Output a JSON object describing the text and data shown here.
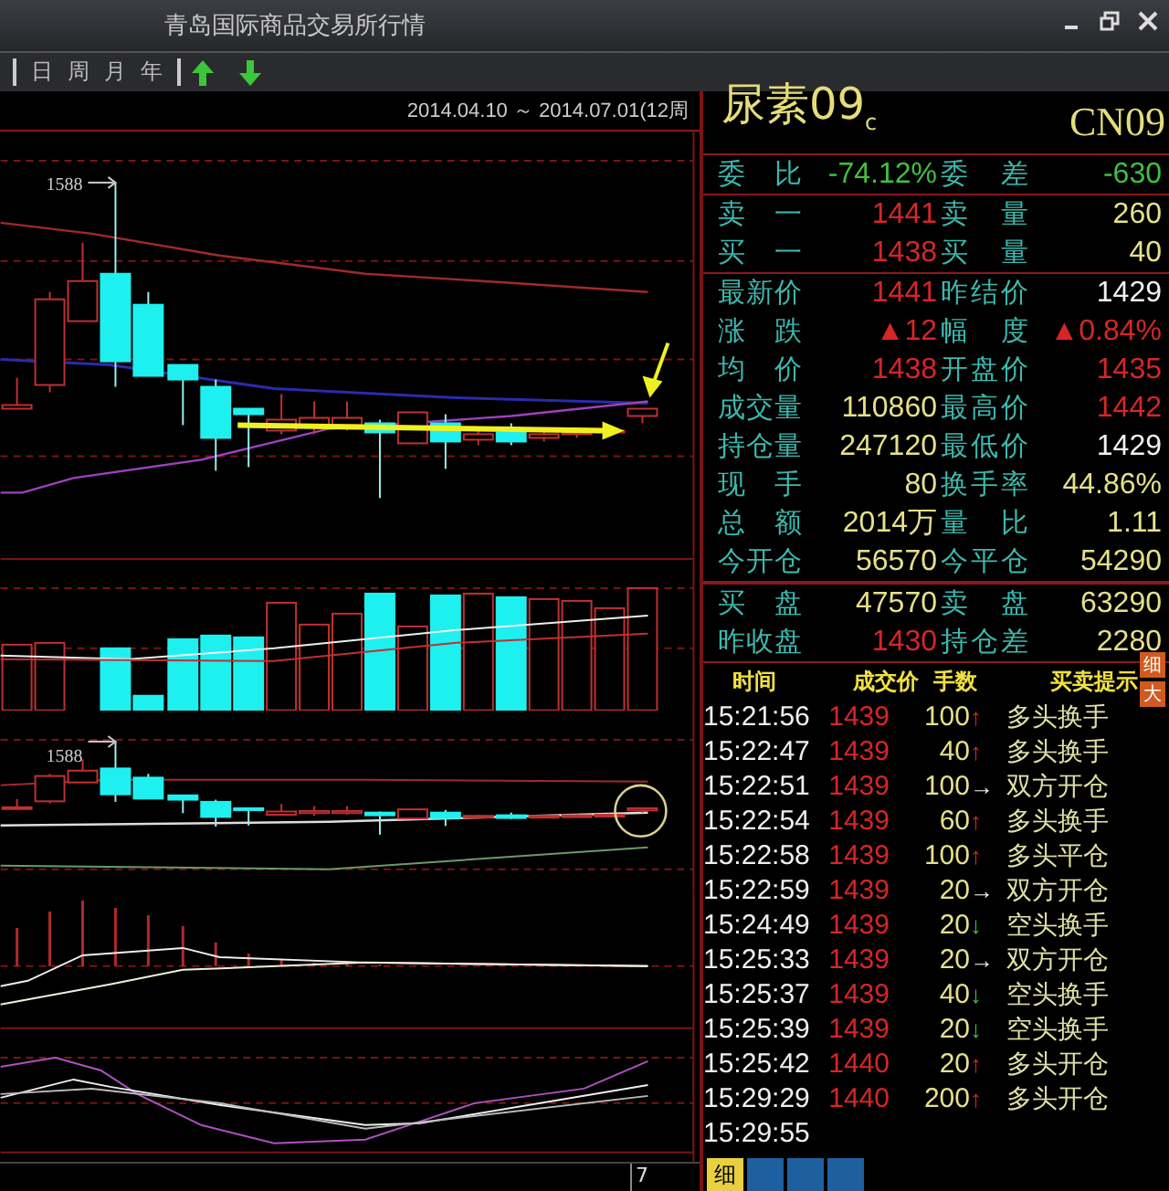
{
  "window": {
    "title": "青岛国际商品交易所行情"
  },
  "toolbar": {
    "periods": [
      {
        "label": "日"
      },
      {
        "label": "周"
      },
      {
        "label": "月"
      },
      {
        "label": "年"
      }
    ]
  },
  "chart": {
    "range": "2014.04.10 ～ 2014.07.01(12周",
    "peak_labels": [
      "1588",
      "1588"
    ],
    "page": "7"
  },
  "quote": {
    "name": "尿素09$_{c}$",
    "code": "CN09",
    "groups": [
      [
        {
          "cells": [
            {
              "label": "委 比",
              "value": "-74.12%",
              "color": "#3fc03f"
            },
            {
              "label": "委 差",
              "value": "-630",
              "color": "#3fc03f"
            }
          ]
        }
      ],
      [
        {
          "cells": [
            {
              "label": "卖 一",
              "value": "1441",
              "color": "#d62626"
            },
            {
              "label": "卖 量",
              "value": "260",
              "color": "#e6e08a"
            }
          ]
        },
        {
          "cells": [
            {
              "label": "买 一",
              "value": "1438",
              "color": "#d62626"
            },
            {
              "label": "买 量",
              "value": "40",
              "color": "#e6e08a"
            }
          ]
        }
      ],
      [
        {
          "cells": [
            {
              "label": "最新价",
              "value": "1441",
              "color": "#d62626"
            },
            {
              "label": "昨结价",
              "value": "1429",
              "color": "#f0f0f0"
            }
          ]
        },
        {
          "cells": [
            {
              "label": "涨 跌",
              "value": "▲12",
              "color": "#d62626"
            },
            {
              "label": "幅 度",
              "value": "▲0.84%",
              "color": "#d62626"
            }
          ]
        },
        {
          "cells": [
            {
              "label": "均 价",
              "value": "1438",
              "color": "#d62626"
            },
            {
              "label": "开盘价",
              "value": "1435",
              "color": "#d62626"
            }
          ]
        },
        {
          "cells": [
            {
              "label": "成交量",
              "value": "110860",
              "color": "#e6e08a"
            },
            {
              "label": "最高价",
              "value": "1442",
              "color": "#d62626"
            }
          ]
        },
        {
          "cells": [
            {
              "label": "持仓量",
              "value": "247120",
              "color": "#e6e08a"
            },
            {
              "label": "最低价",
              "value": "1429",
              "color": "#f0f0f0"
            }
          ]
        },
        {
          "cells": [
            {
              "label": "现 手",
              "value": "80",
              "color": "#e6e08a"
            },
            {
              "label": "换手率",
              "value": "44.86%",
              "color": "#e6e08a"
            }
          ]
        },
        {
          "cells": [
            {
              "label": "总 额",
              "value": "2014万",
              "color": "#e6e08a"
            },
            {
              "label": "量 比",
              "value": "1.11",
              "color": "#e6e08a"
            }
          ]
        },
        {
          "cells": [
            {
              "label": "今开仓",
              "value": "56570",
              "color": "#e6e08a"
            },
            {
              "label": "今平仓",
              "value": "54290",
              "color": "#e6e08a"
            }
          ]
        }
      ],
      [
        {
          "cells": [
            {
              "label": "买 盘",
              "value": "47570",
              "color": "#e6e08a"
            },
            {
              "label": "卖 盘",
              "value": "63290",
              "color": "#e6e08a"
            }
          ]
        },
        {
          "cells": [
            {
              "label": "昨收盘",
              "value": "1430",
              "color": "#d62626"
            },
            {
              "label": "持仓差",
              "value": "2280",
              "color": "#e6e08a"
            }
          ]
        }
      ]
    ]
  },
  "trades": {
    "columns": [
      "时间",
      "成交价",
      "手数",
      "买卖提示"
    ],
    "buttons": [
      "细",
      "大"
    ],
    "rows": [
      {
        "time": "15:21:56",
        "price": "1439",
        "volume": "100",
        "arrow": "↑",
        "color": "#d62626",
        "hint": "多头换手"
      },
      {
        "time": "15:22:47",
        "price": "1439",
        "volume": "40",
        "arrow": "↑",
        "color": "#d62626",
        "hint": "多头换手"
      },
      {
        "time": "15:22:51",
        "price": "1439",
        "volume": "100",
        "arrow": "→",
        "color": "#f0f0f0",
        "hint": "双方开仓"
      },
      {
        "time": "15:22:54",
        "price": "1439",
        "volume": "60",
        "arrow": "↑",
        "color": "#d62626",
        "hint": "多头换手"
      },
      {
        "time": "15:22:58",
        "price": "1439",
        "volume": "100",
        "arrow": "↑",
        "color": "#d62626",
        "hint": "多头平仓"
      },
      {
        "time": "15:22:59",
        "price": "1439",
        "volume": "20",
        "arrow": "→",
        "color": "#f0f0f0",
        "hint": "双方开仓"
      },
      {
        "time": "15:24:49",
        "price": "1439",
        "volume": "20",
        "arrow": "↓",
        "color": "#3fc03f",
        "hint": "空头换手"
      },
      {
        "time": "15:25:33",
        "price": "1439",
        "volume": "20",
        "arrow": "→",
        "color": "#f0f0f0",
        "hint": "双方开仓"
      },
      {
        "time": "15:25:37",
        "price": "1439",
        "volume": "40",
        "arrow": "↓",
        "color": "#3fc03f",
        "hint": "空头换手"
      },
      {
        "time": "15:25:39",
        "price": "1439",
        "volume": "20",
        "arrow": "↓",
        "color": "#3fc03f",
        "hint": "空头换手"
      },
      {
        "time": "15:25:42",
        "price": "1440",
        "volume": "20",
        "arrow": "↑",
        "color": "#d62626",
        "hint": "多头开仓"
      },
      {
        "time": "15:29:29",
        "price": "1440",
        "volume": "200",
        "arrow": "↑",
        "color": "#d62626",
        "hint": "多头开仓"
      },
      {
        "time": "15:29:55"
      }
    ]
  },
  "bottom_tabs": [
    {
      "label": "细",
      "selected": true
    },
    {
      "selected": false
    },
    {
      "selected": false
    },
    {
      "selected": false
    }
  ]
}
